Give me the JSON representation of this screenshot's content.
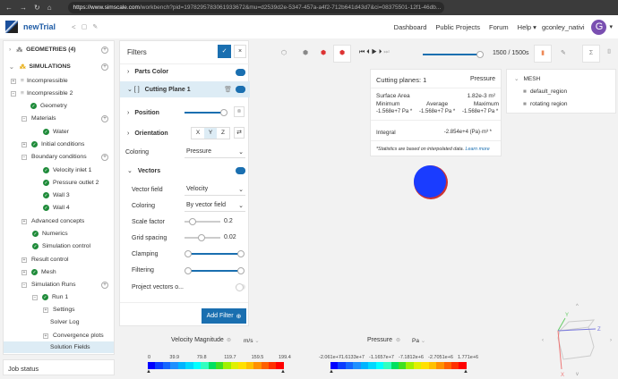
{
  "browser": {
    "url_host": "https://www.simscale.com",
    "url_path": "/workbench?pid=1978295783061933672&mu=d2539d2e-5347-457a-a4f2-712b641d43d7&ci=08375501-12f1-46db..."
  },
  "header": {
    "project": "newTrial",
    "nav": [
      "Dashboard",
      "Public Projects",
      "Forum",
      "Help"
    ],
    "user": "gconley_nativi",
    "avatar": "G"
  },
  "tree": {
    "geometries": "GEOMETRIES (4)",
    "simulations": "SIMULATIONS",
    "items": [
      "Incompressible",
      "Incompressible 2",
      "Geometry",
      "Materials",
      "Water",
      "Initial conditions",
      "Boundary conditions",
      "Velocity inlet 1",
      "Pressure outlet 2",
      "Wall 3",
      "Wall 4",
      "Advanced concepts",
      "Numerics",
      "Simulation control",
      "Result control",
      "Mesh",
      "Simulation Runs",
      "Run 1",
      "Settings",
      "Solver Log",
      "Convergence plots",
      "Solution Fields"
    ]
  },
  "job_status": "Job status",
  "filters": {
    "title": "Filters",
    "parts_color": "Parts Color",
    "cutting_plane": "Cutting Plane 1",
    "position": "Position",
    "orientation": "Orientation",
    "axes": [
      "X",
      "Y",
      "Z"
    ],
    "coloring_label": "Coloring",
    "coloring_value": "Pressure",
    "vectors": "Vectors",
    "vector_field_label": "Vector field",
    "vector_field_value": "Velocity",
    "vcoloring_label": "Coloring",
    "vcoloring_value": "By vector field",
    "scale_factor_label": "Scale factor",
    "scale_factor": "0.2",
    "grid_spacing_label": "Grid spacing",
    "grid_spacing": "0.02",
    "clamping": "Clamping",
    "filtering": "Filtering",
    "project_vectors": "Project vectors o...",
    "add_filter": "Add Filter",
    "position_fraction": 0.95
  },
  "player": {
    "time": "1500 / 1500s",
    "progress": 1.0
  },
  "stats": {
    "title": "Cutting planes: 1",
    "field": "Pressure",
    "surface_area_label": "Surface Area",
    "surface_area": "1.82e-3 m²",
    "headers": [
      "Minimum",
      "Average",
      "Maximum"
    ],
    "values": [
      "-1.568e+7 Pa *",
      "-1.568e+7 Pa *",
      "-1.568e+7 Pa *"
    ],
    "integral_label": "Integral",
    "integral": "-2.854e+4 (Pa)·m³ *",
    "note": "*Statistics are based on interpolated data.",
    "learn_more": "Learn more"
  },
  "mesh": {
    "title": "MESH",
    "regions": [
      "default_region",
      "rotating region"
    ]
  },
  "legend_velocity": {
    "title": "Velocity Magnitude",
    "unit": "m/s",
    "ticks": [
      "0",
      "39.9",
      "79.8",
      "119.7",
      "159.5",
      "199.4"
    ]
  },
  "legend_pressure": {
    "title": "Pressure",
    "unit": "Pa",
    "ticks": [
      "-2.061e+7",
      "-1.6133e+7",
      "-1.1657e+7",
      "-7.1812e+6",
      "-2.7051e+6",
      "1.771e+6"
    ]
  },
  "colors": {
    "accent": "#1a6fb0",
    "selected_bg": "#ddecf5"
  }
}
